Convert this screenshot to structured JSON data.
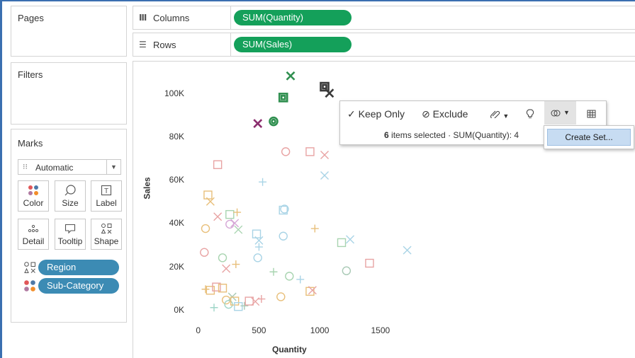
{
  "cards": {
    "pages_title": "Pages",
    "filters_title": "Filters",
    "marks_title": "Marks"
  },
  "marks": {
    "mark_type": "Automatic",
    "buttons": {
      "color": "Color",
      "size": "Size",
      "label": "Label",
      "detail": "Detail",
      "tooltip": "Tooltip",
      "shape": "Shape"
    },
    "pills": [
      "Region",
      "Sub-Category"
    ]
  },
  "shelves": {
    "columns_label": "Columns",
    "columns_pill": "SUM(Quantity)",
    "rows_label": "Rows",
    "rows_pill": "SUM(Sales)"
  },
  "toolbar": {
    "keep_only": "Keep Only",
    "exclude": "Exclude",
    "selected_count": "6",
    "selected_text": "items selected",
    "sum_text": "· SUM(Quantity): 4"
  },
  "menu": {
    "create_set": "Create Set..."
  },
  "colors": {
    "accent_blue": "#3c8bb4",
    "pill_green": "#14a05a",
    "menu_highlight": "#c7dcf2"
  },
  "chart_data": {
    "type": "scatter",
    "xlabel": "Quantity",
    "ylabel": "Sales",
    "x_ticks": [
      "0",
      "500",
      "1000",
      "1500"
    ],
    "y_ticks": [
      "0K",
      "20K",
      "40K",
      "60K",
      "80K",
      "100K"
    ],
    "xlim": [
      -80,
      1950
    ],
    "ylim": [
      -3000,
      112000
    ],
    "points": [
      {
        "x": 60,
        "y": 9500,
        "shape": "plus",
        "color": "#e8bf7a"
      },
      {
        "x": 100,
        "y": 9000,
        "shape": "square",
        "color": "#e8bf7a"
      },
      {
        "x": 130,
        "y": 1000,
        "shape": "plus",
        "color": "#9fd6c8"
      },
      {
        "x": 150,
        "y": 10500,
        "shape": "square",
        "color": "#e8a3a3"
      },
      {
        "x": 200,
        "y": 10000,
        "shape": "square",
        "color": "#e8bf7a"
      },
      {
        "x": 230,
        "y": 4500,
        "shape": "circle",
        "color": "#e8bf7a"
      },
      {
        "x": 250,
        "y": 2500,
        "shape": "circle",
        "color": "#9fd6c8"
      },
      {
        "x": 280,
        "y": 6000,
        "shape": "cross",
        "color": "#a8c9b5"
      },
      {
        "x": 300,
        "y": 4000,
        "shape": "square",
        "color": "#e8bf7a"
      },
      {
        "x": 330,
        "y": 1500,
        "shape": "square",
        "color": "#a9d4e6"
      },
      {
        "x": 380,
        "y": 1800,
        "shape": "plus",
        "color": "#a8c9b5"
      },
      {
        "x": 420,
        "y": 4000,
        "shape": "square",
        "color": "#e8a3a3"
      },
      {
        "x": 470,
        "y": 3800,
        "shape": "cross",
        "color": "#e8a3a3"
      },
      {
        "x": 520,
        "y": 5000,
        "shape": "plus",
        "color": "#e8a3a3"
      },
      {
        "x": 680,
        "y": 6000,
        "shape": "circle",
        "color": "#e8bf7a"
      },
      {
        "x": 920,
        "y": 8500,
        "shape": "square",
        "color": "#e8bf7a"
      },
      {
        "x": 940,
        "y": 9000,
        "shape": "cross",
        "color": "#e8a3a3"
      },
      {
        "x": 50,
        "y": 26500,
        "shape": "circle",
        "color": "#e8a3a3"
      },
      {
        "x": 60,
        "y": 37500,
        "shape": "circle",
        "color": "#e8bf7a"
      },
      {
        "x": 80,
        "y": 53000,
        "shape": "square",
        "color": "#e8bf7a"
      },
      {
        "x": 100,
        "y": 50000,
        "shape": "cross",
        "color": "#e8bf7a"
      },
      {
        "x": 160,
        "y": 67000,
        "shape": "square",
        "color": "#e8a3a3"
      },
      {
        "x": 160,
        "y": 43000,
        "shape": "cross",
        "color": "#e8a3a3"
      },
      {
        "x": 200,
        "y": 24000,
        "shape": "circle",
        "color": "#a8d4b0"
      },
      {
        "x": 230,
        "y": 19000,
        "shape": "cross",
        "color": "#e8a3a3"
      },
      {
        "x": 260,
        "y": 44000,
        "shape": "square",
        "color": "#a8d4b0"
      },
      {
        "x": 260,
        "y": 39500,
        "shape": "circle",
        "color": "#d6a8d6"
      },
      {
        "x": 300,
        "y": 40000,
        "shape": "cross",
        "color": "#d6a8d6"
      },
      {
        "x": 310,
        "y": 21000,
        "shape": "plus",
        "color": "#e8bf7a"
      },
      {
        "x": 320,
        "y": 45000,
        "shape": "plus",
        "color": "#e8bf7a"
      },
      {
        "x": 330,
        "y": 37000,
        "shape": "cross",
        "color": "#a8d4b0"
      },
      {
        "x": 480,
        "y": 35000,
        "shape": "square",
        "color": "#a9d4e6"
      },
      {
        "x": 490,
        "y": 24000,
        "shape": "circle",
        "color": "#a9d4e6"
      },
      {
        "x": 500,
        "y": 29000,
        "shape": "plus",
        "color": "#a9d4e6"
      },
      {
        "x": 500,
        "y": 32000,
        "shape": "cross",
        "color": "#a9d4e6"
      },
      {
        "x": 530,
        "y": 59000,
        "shape": "plus",
        "color": "#a9d4e6"
      },
      {
        "x": 620,
        "y": 17500,
        "shape": "plus",
        "color": "#a8d4b0"
      },
      {
        "x": 700,
        "y": 34000,
        "shape": "circle",
        "color": "#a9d4e6"
      },
      {
        "x": 700,
        "y": 46000,
        "shape": "square",
        "color": "#a9d4e6"
      },
      {
        "x": 710,
        "y": 46500,
        "shape": "circle",
        "color": "#a9d4e6"
      },
      {
        "x": 720,
        "y": 73000,
        "shape": "circle",
        "color": "#e8a3a3"
      },
      {
        "x": 750,
        "y": 15500,
        "shape": "circle",
        "color": "#a8d4b0"
      },
      {
        "x": 840,
        "y": 14000,
        "shape": "plus",
        "color": "#a9d4e6"
      },
      {
        "x": 920,
        "y": 73000,
        "shape": "square",
        "color": "#e8a3a3"
      },
      {
        "x": 960,
        "y": 37500,
        "shape": "plus",
        "color": "#e8bf7a"
      },
      {
        "x": 1040,
        "y": 71500,
        "shape": "cross",
        "color": "#e8a3a3"
      },
      {
        "x": 1040,
        "y": 62000,
        "shape": "cross",
        "color": "#a9d4e6"
      },
      {
        "x": 1180,
        "y": 31000,
        "shape": "square",
        "color": "#a8d4b0"
      },
      {
        "x": 1220,
        "y": 18000,
        "shape": "circle",
        "color": "#a8c9b5"
      },
      {
        "x": 1250,
        "y": 32500,
        "shape": "cross",
        "color": "#a9d4e6"
      },
      {
        "x": 1410,
        "y": 21500,
        "shape": "square",
        "color": "#e8a3a3"
      },
      {
        "x": 1720,
        "y": 27500,
        "shape": "cross",
        "color": "#a9d4e6"
      },
      {
        "x": 760,
        "y": 108000,
        "shape": "cross",
        "color": "#2f8f4f",
        "selected": true
      },
      {
        "x": 700,
        "y": 98000,
        "shape": "square",
        "color": "#2f8f4f",
        "selected": true
      },
      {
        "x": 1040,
        "y": 103000,
        "shape": "square",
        "color": "#3a3a3a",
        "selected": true
      },
      {
        "x": 1080,
        "y": 100000,
        "shape": "cross",
        "color": "#3a3a3a",
        "selected": true
      },
      {
        "x": 490,
        "y": 86000,
        "shape": "cross",
        "color": "#8b2e6e",
        "selected": true
      },
      {
        "x": 620,
        "y": 87000,
        "shape": "circle",
        "color": "#2f8f4f",
        "selected": true
      }
    ]
  }
}
